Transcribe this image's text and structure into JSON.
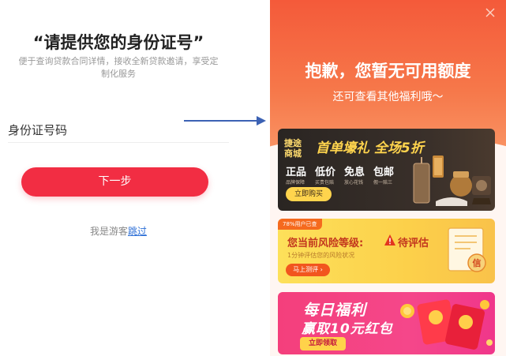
{
  "left_screen": {
    "title": "“请提供您的身份证号”",
    "description": "便于查询贷款合同详情，接收全新贷款邀请，享受定制化服务",
    "id_label": "身份证号码",
    "next_button": "下一步",
    "guest_prefix": "我是游客",
    "skip_link": "跳过"
  },
  "arrow": {
    "color": "#3c62b4"
  },
  "right_screen": {
    "title": "抱歉，您暂无可用额度",
    "subtitle": "还可查看其他福利哦～",
    "close_icon": "close-icon",
    "banner_mall": {
      "tag_line1": "捷途",
      "tag_line2": "商城",
      "headline": "首单壕礼 全场5折",
      "features": [
        {
          "main": "正品",
          "sub": "品牌保障"
        },
        {
          "main": "低价",
          "sub": "买贵包赔"
        },
        {
          "main": "免息",
          "sub": "放心花钱"
        },
        {
          "main": "包邮",
          "sub": "假一赔三"
        }
      ],
      "button": "立即购买"
    },
    "banner_risk": {
      "badge": "78%用户已查",
      "title": "您当前风险等级:",
      "status": "待评估",
      "subtitle": "1分钟评估您的风险状况",
      "button": "马上测评 ›",
      "doc_stamp": "信"
    },
    "banner_welfare": {
      "title": "每日福利",
      "subtitle": "赢取10元红包",
      "button": "立即领取"
    }
  }
}
